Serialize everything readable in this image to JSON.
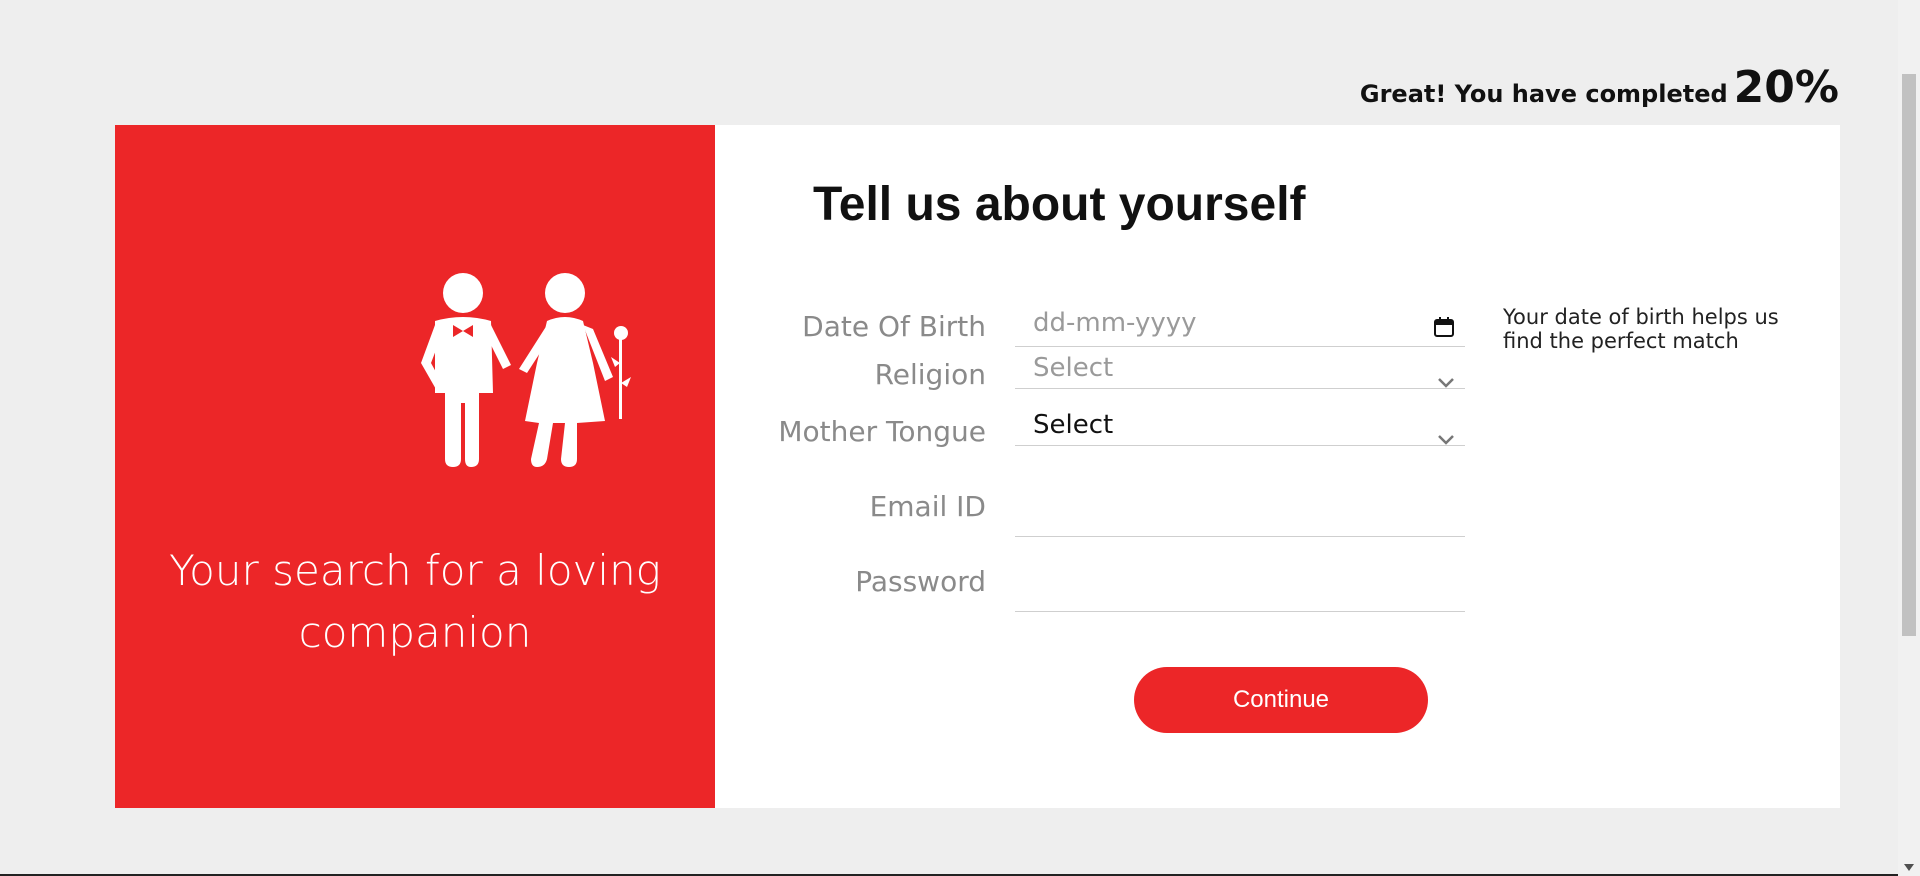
{
  "progress": {
    "message": "Great! You have completed",
    "percent": "20%",
    "value": 0.2
  },
  "left_panel": {
    "tagline": "Your search for a loving companion",
    "illustration": "couple-icon",
    "background_color": "#ec2628"
  },
  "form": {
    "title": "Tell us about yourself",
    "fields": [
      {
        "label": "Date Of Birth",
        "placeholder": "dd-mm-yyyy",
        "icon": "calendar-icon"
      },
      {
        "label": "Religion",
        "value": "Select",
        "icon": "chevron-down-icon"
      },
      {
        "label": "Mother Tongue",
        "value": "Select",
        "icon": "chevron-down-icon"
      },
      {
        "label": "Email ID",
        "value": ""
      },
      {
        "label": "Password",
        "value": ""
      }
    ],
    "dob_hint": "Your date of birth helps us find the perfect match",
    "continue_label": "Continue"
  },
  "colors": {
    "accent": "#ec2628",
    "page_background": "#eeeeee"
  }
}
